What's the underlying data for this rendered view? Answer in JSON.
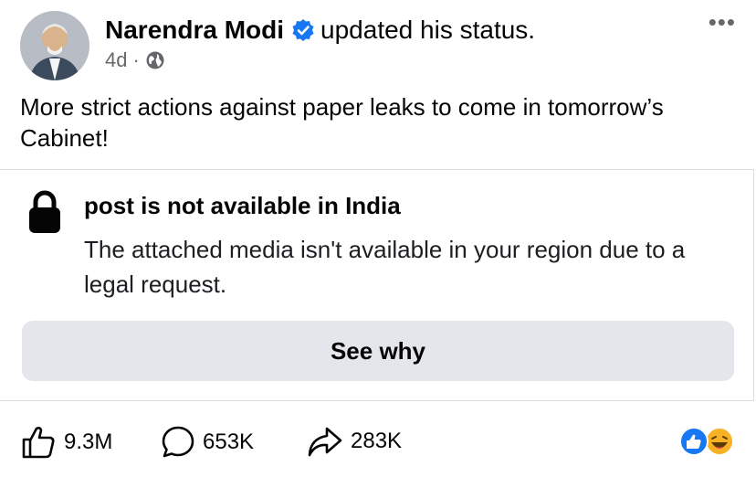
{
  "post": {
    "author": "Narendra Modi",
    "action": "updated his status.",
    "time": "4d",
    "separator": "·",
    "text": "More strict actions against paper leaks to come in tomorrow’s Cabinet!"
  },
  "notice": {
    "title": "post is not available in India",
    "body": "The attached media isn't available in your region due to a legal request.",
    "button_label": "See why"
  },
  "stats": {
    "likes": "9.3M",
    "comments": "653K",
    "shares": "283K"
  },
  "colors": {
    "verified_blue": "#1877f2",
    "button_bg": "#e4e6eb",
    "secondary_text": "#65676b"
  },
  "icons": [
    "verified-badge-icon",
    "globe-icon",
    "more-options-icon",
    "lock-icon",
    "like-icon",
    "comment-icon",
    "share-icon",
    "like-reaction-icon",
    "haha-reaction-icon"
  ]
}
